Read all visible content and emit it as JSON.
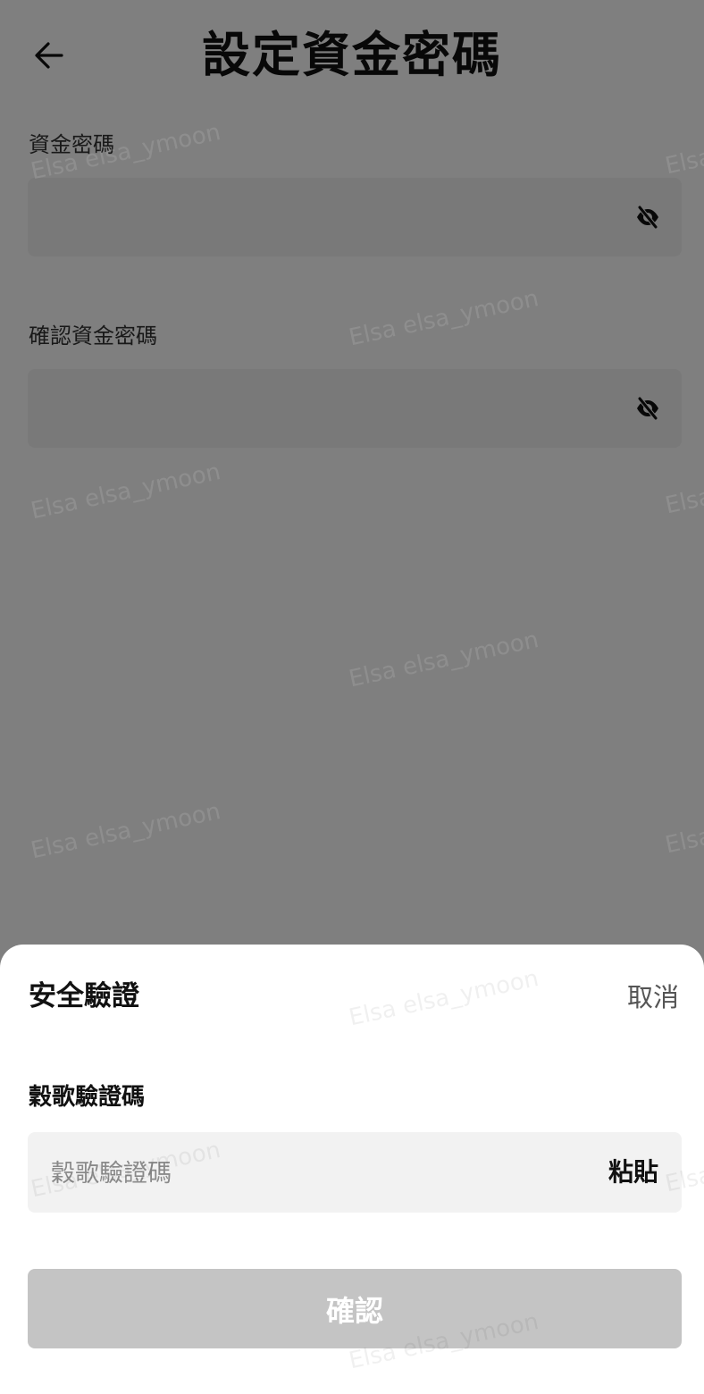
{
  "header": {
    "title": "設定資金密碼",
    "back_icon": "arrow-left-icon"
  },
  "form": {
    "fund_password_label": "資金密碼",
    "confirm_fund_password_label": "確認資金密碼",
    "fund_password_value": "",
    "confirm_fund_password_value": "",
    "eye_icon": "eye-off-icon"
  },
  "sheet": {
    "title": "安全驗證",
    "cancel_label": "取消",
    "code_label": "穀歌驗證碼",
    "code_placeholder": "穀歌驗證碼",
    "code_value": "",
    "paste_label": "粘貼",
    "confirm_label": "確認"
  },
  "watermark": {
    "text": "Elsa elsa_ymoon",
    "partial_text": "Elsa"
  },
  "colors": {
    "overlay": "#7f7f7f",
    "input_bg": "#f2f2f2",
    "confirm_disabled_bg": "#c4c4c4",
    "sheet_bg": "#ffffff"
  }
}
